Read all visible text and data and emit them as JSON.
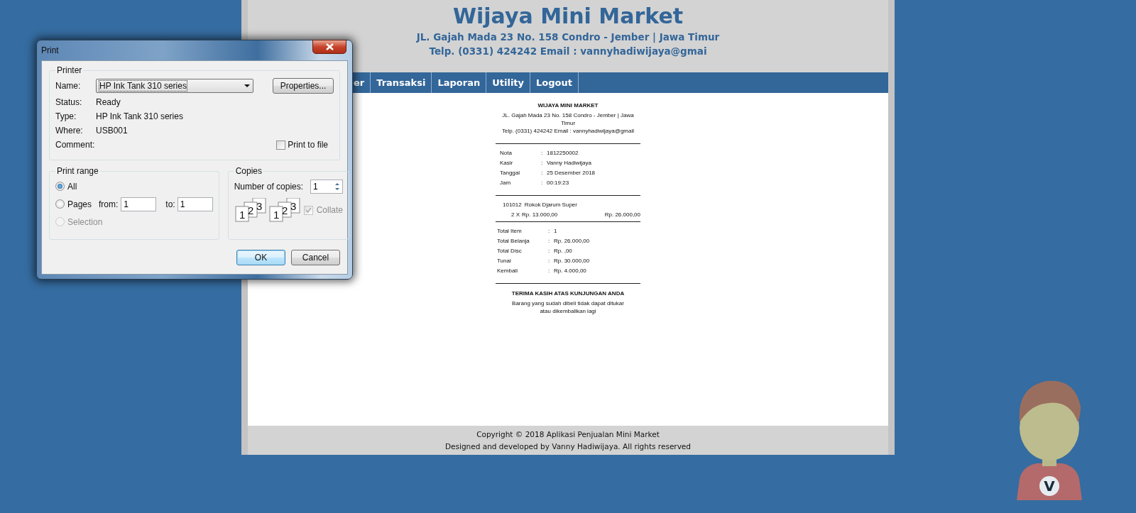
{
  "header": {
    "title": "Wijaya Mini Market",
    "address": "JL. Gajah Mada 23 No. 158 Condro - Jember | Jawa Timur",
    "contact": "Telp. (0331) 424242 Email : vannyhadiwijaya@gmai"
  },
  "menu": [
    {
      "label": "er"
    },
    {
      "label": "Transaksi"
    },
    {
      "label": "Laporan"
    },
    {
      "label": "Utility"
    },
    {
      "label": "Logout"
    }
  ],
  "receipt": {
    "store": "WIJAYA MINI MARKET",
    "address": "JL. Gajah Mada 23 No. 158 Condro - Jember | Jawa Timur",
    "contact": "Telp. (0331) 424242 Email : vannyhadiwijaya@gmail",
    "info": [
      {
        "label": "Nota",
        "sep": ":",
        "value": "1812250002"
      },
      {
        "label": "Kasir",
        "sep": ":",
        "value": "Vanny Hadiwijaya"
      },
      {
        "label": "Tanggal",
        "sep": ":",
        "value": "25 Desember 2018"
      },
      {
        "label": "Jam",
        "sep": ":",
        "value": "00:19:23"
      }
    ],
    "items": [
      {
        "code": "101012",
        "name": "Rokok Djarum Super",
        "qty": "2 X",
        "price": "Rp. 13.000,00",
        "subtotal": "Rp. 26.000,00"
      }
    ],
    "totals": [
      {
        "label": "Total Item",
        "sep": ":",
        "value": "1"
      },
      {
        "label": "Total Belanja",
        "sep": ":",
        "value": "Rp. 26.000,00"
      },
      {
        "label": "Total Disc",
        "sep": ":",
        "value": "Rp. ,00"
      },
      {
        "label": "Tunai",
        "sep": ":",
        "value": "Rp. 30.000,00"
      },
      {
        "label": "Kembali",
        "sep": ":",
        "value": "Rp. 4.000,00"
      }
    ],
    "thanks": "TERIMA KASIH ATAS KUNJUNGAN ANDA",
    "note": "Barang yang sudah dibeli tidak dapat ditukar atau dikembalikan lagi"
  },
  "footer": {
    "copyright": "Copyright © 2018 Aplikasi Penjualan Mini Market",
    "credits": "Designed and developed by Vanny Hadiwijaya. All rights reserved"
  },
  "avatar": {
    "badge": "V"
  },
  "print_dialog": {
    "title": "Print",
    "printer_group": "Printer",
    "name_label": "Name:",
    "printer": "HP Ink Tank 310 series",
    "properties": "Properties...",
    "details": [
      {
        "label": "Status:",
        "value": "Ready"
      },
      {
        "label": "Type:",
        "value": "HP Ink Tank 310 series"
      },
      {
        "label": "Where:",
        "value": "USB001"
      },
      {
        "label": "Comment:"
      }
    ],
    "print_to_file": {
      "label": "Print to file",
      "checked": false
    },
    "range": {
      "title": "Print range",
      "from_label": "from:",
      "from": "1",
      "to_label": "to:",
      "to": "1",
      "options": [
        {
          "label": "All",
          "selected": true,
          "disabled": false
        },
        {
          "label": "Pages",
          "selected": false,
          "disabled": false
        },
        {
          "label": "Selection",
          "selected": false,
          "disabled": true
        }
      ]
    },
    "copies": {
      "title": "Copies",
      "count_label": "Number of copies:",
      "count": "1",
      "stacks": [
        [
          "1",
          "2",
          "3"
        ],
        [
          "1",
          "2",
          "3"
        ]
      ],
      "collate": {
        "label": "Collate",
        "checked": true,
        "disabled": true
      }
    },
    "buttons": [
      {
        "label": "OK",
        "default": true
      },
      {
        "label": "Cancel",
        "default": false
      }
    ]
  }
}
